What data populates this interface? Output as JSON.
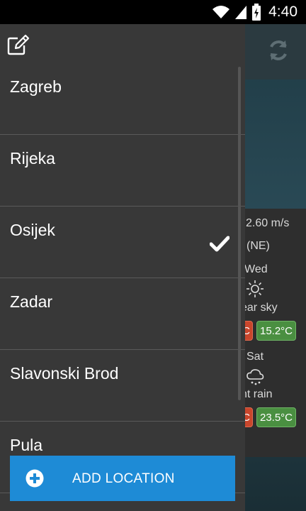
{
  "status_bar": {
    "time": "4:40",
    "icons": [
      "wifi-icon",
      "signal-icon",
      "battery-charging-icon"
    ]
  },
  "background_app": {
    "icons": [
      "refresh-icon",
      "sun-icon",
      "cloud-rain-icon"
    ],
    "wind_speed": "2.60 m/s",
    "wind_direction": "(NE)",
    "forecast": [
      {
        "day": "Wed",
        "condition": "ear sky",
        "min_temp": "C",
        "max_temp": "15.2°C"
      },
      {
        "day": "Sat",
        "condition": "ht rain",
        "min_temp": "C",
        "max_temp": "23.5°C"
      }
    ]
  },
  "drawer": {
    "header_icon": "edit-icon",
    "locations": [
      {
        "name": "Zagreb",
        "selected": false
      },
      {
        "name": "Rijeka",
        "selected": false
      },
      {
        "name": "Osijek",
        "selected": true
      },
      {
        "name": "Zadar",
        "selected": false
      },
      {
        "name": "Slavonski Brod",
        "selected": false
      },
      {
        "name": "Pula",
        "selected": false
      }
    ],
    "add_button_label": "ADD LOCATION",
    "add_button_icon": "plus-circle-icon"
  },
  "colors": {
    "drawer_bg": "#383838",
    "accent": "#1e8bd6",
    "temp_low": "#c9462c",
    "temp_high": "#4a8f41"
  }
}
